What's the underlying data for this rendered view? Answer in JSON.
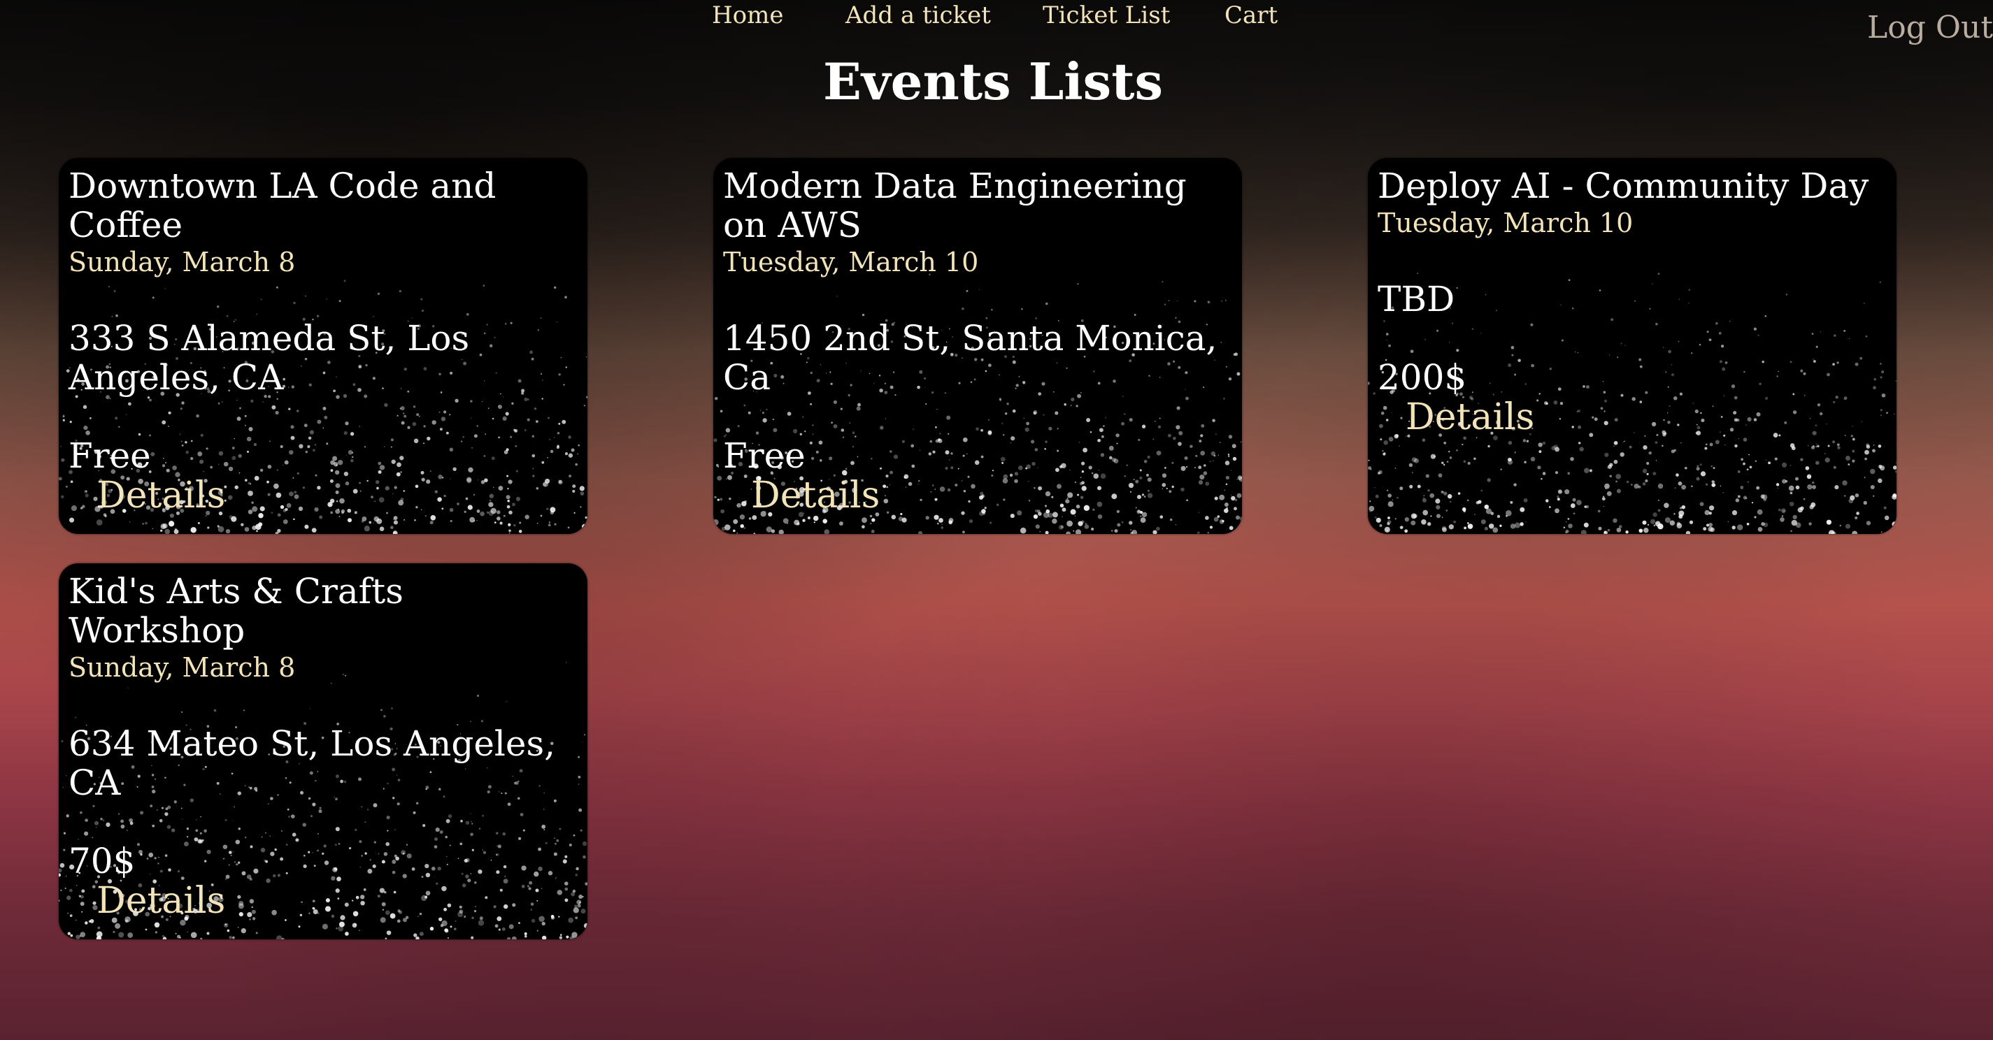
{
  "nav": {
    "home": "Home",
    "add_ticket": "Add a ticket",
    "ticket_list": "Ticket List",
    "cart": "Cart",
    "logout": "Log Out"
  },
  "page": {
    "title": "Events Lists"
  },
  "events": [
    {
      "title": "Downtown LA Code and Coffee",
      "date": "Sunday, March 8",
      "address": "333 S Alameda St, Los Angeles, CA",
      "price": "Free",
      "details_label": "Details"
    },
    {
      "title": "Modern Data Engineering on AWS",
      "date": "Tuesday, March 10",
      "address": "1450 2nd St, Santa Monica, Ca",
      "price": "Free",
      "details_label": "Details"
    },
    {
      "title": "Deploy AI - Community Day",
      "date": "Tuesday, March 10",
      "address": "TBD",
      "price": "200$",
      "details_label": "Details"
    },
    {
      "title": "Kid's Arts & Crafts Workshop",
      "date": "Sunday, March 8",
      "address": "634 Mateo St, Los Angeles, CA",
      "price": "70$",
      "details_label": "Details"
    }
  ],
  "colors": {
    "accent": "#f2e3b8",
    "card_background": "#000000",
    "logout": "#b8ada0"
  }
}
